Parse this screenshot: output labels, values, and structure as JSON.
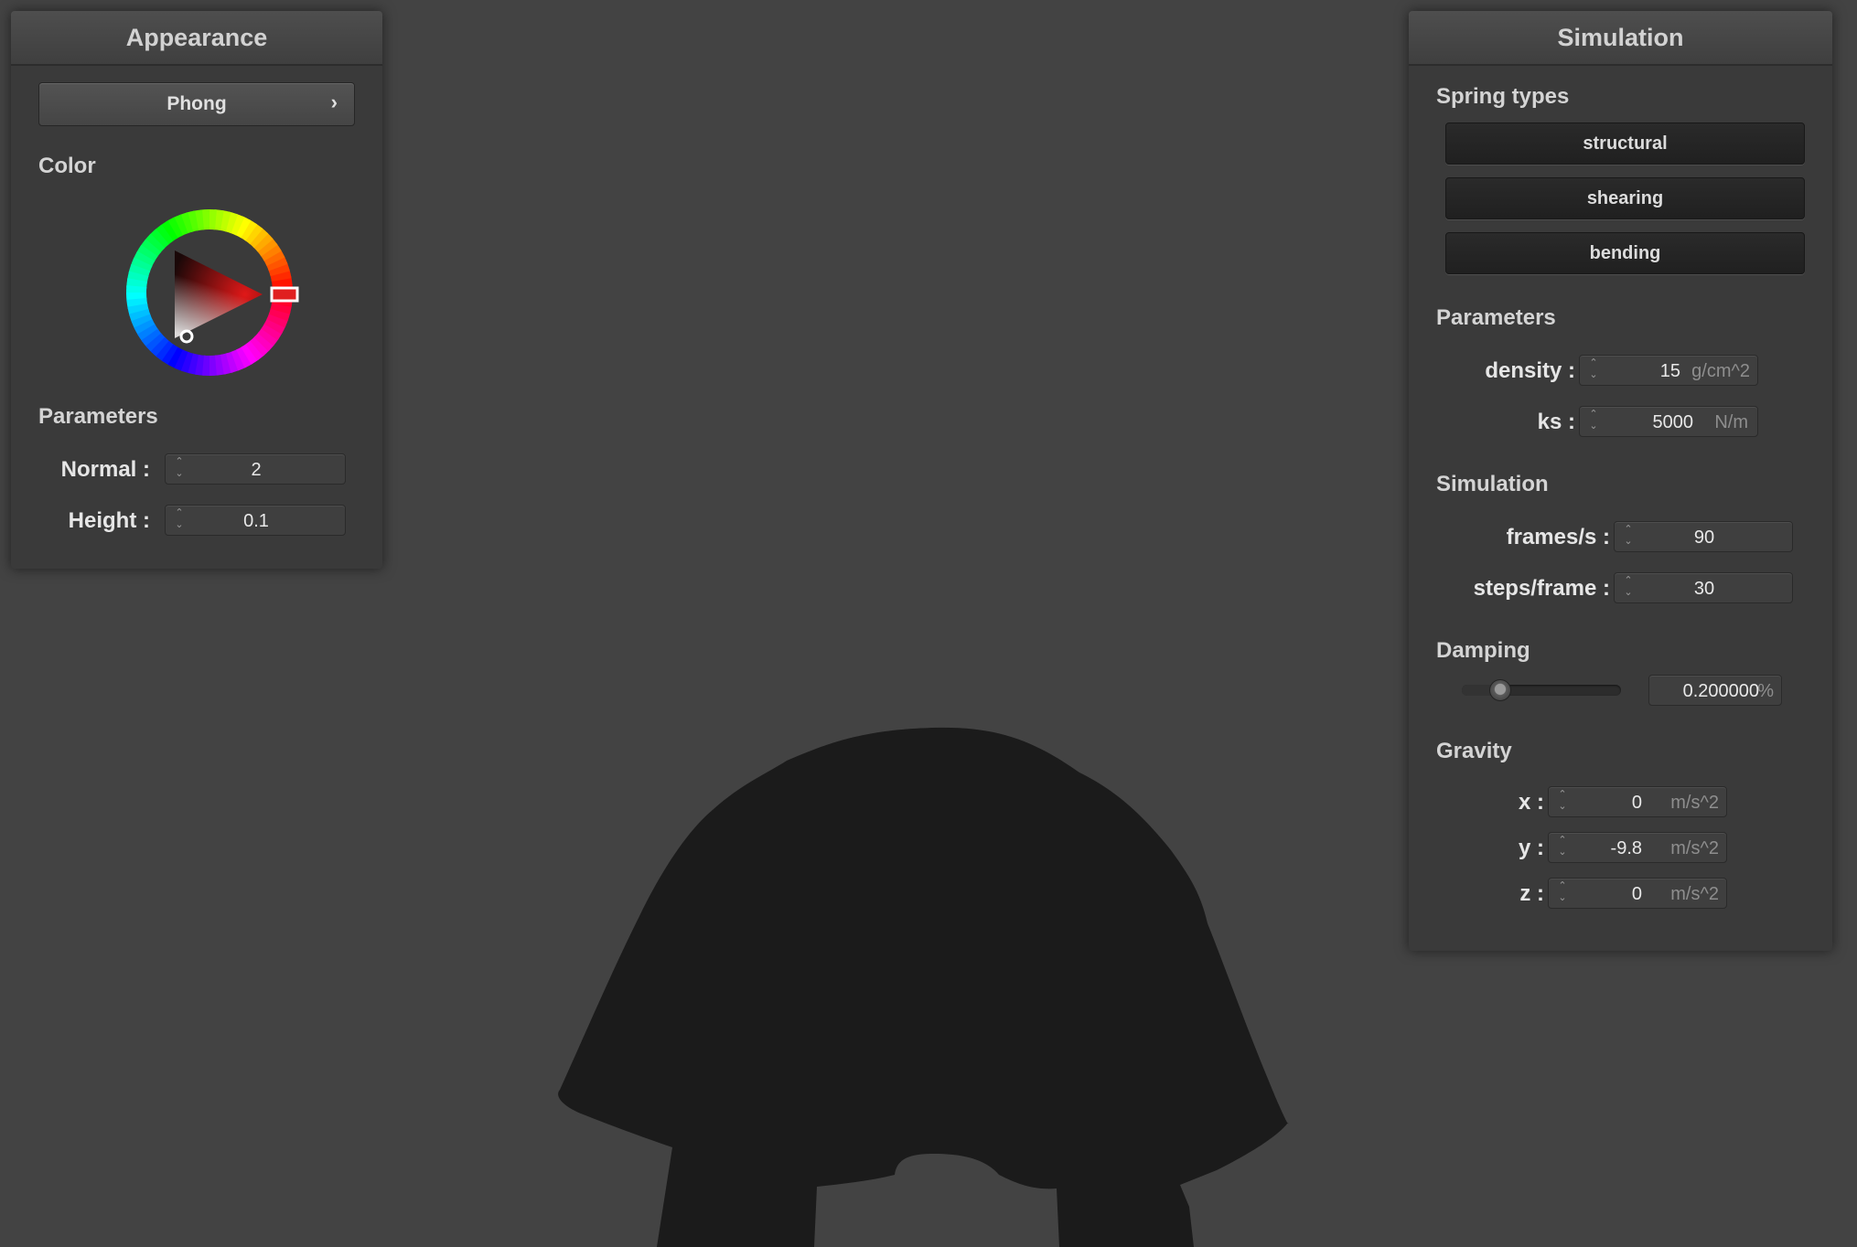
{
  "appearance": {
    "title": "Appearance",
    "shading_button": "Phong",
    "shading_chevron": "›",
    "color_label": "Color",
    "color_value": "#e02020",
    "parameters_label": "Parameters",
    "normal_label": "Normal :",
    "normal_value": "2",
    "height_label": "Height :",
    "height_value": "0.1"
  },
  "simulation": {
    "title": "Simulation",
    "spring_types_label": "Spring types",
    "spring_types": [
      "structural",
      "shearing",
      "bending"
    ],
    "parameters_label": "Parameters",
    "density_label": "density :",
    "density_value": "15",
    "density_unit": "g/cm^2",
    "ks_label": "ks :",
    "ks_value": "5000",
    "ks_unit": "N/m",
    "simulation_label": "Simulation",
    "fps_label": "frames/s :",
    "fps_value": "90",
    "steps_label": "steps/frame :",
    "steps_value": "30",
    "damping_label": "Damping",
    "damping_value": "0.200000",
    "damping_unit": "%",
    "damping_slider_fraction": 0.2,
    "gravity_label": "Gravity",
    "gx_label": "x :",
    "gx_value": "0",
    "gy_label": "y :",
    "gy_value": "-9.8",
    "gz_label": "z :",
    "gz_value": "0",
    "gravity_unit": "m/s^2"
  },
  "icons": {
    "spin_arrows": "⌃\n⌄"
  },
  "colors": {
    "background": "#434343",
    "cloth": "#1b1b1b",
    "panel": "#3a3a3a"
  }
}
